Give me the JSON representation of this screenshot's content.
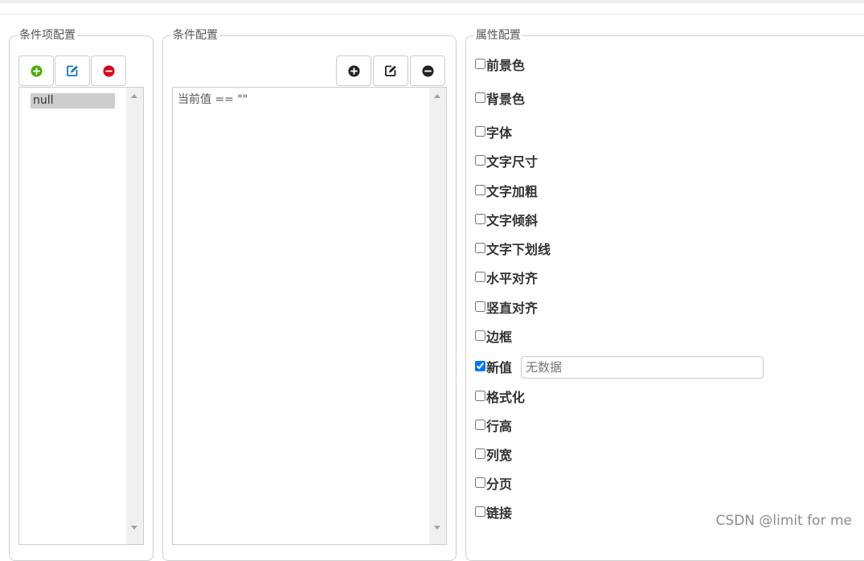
{
  "panels": {
    "condition_items": {
      "legend": "条件项配置",
      "items": [
        "null"
      ]
    },
    "condition_config": {
      "legend": "条件配置",
      "expression": "当前值 == \"\""
    },
    "property_config": {
      "legend": "属性配置",
      "properties": [
        {
          "label": "前景色",
          "checked": false
        },
        {
          "label": "背景色",
          "checked": false
        },
        {
          "label": "字体",
          "checked": false
        },
        {
          "label": "文字尺寸",
          "checked": false
        },
        {
          "label": "文字加粗",
          "checked": false
        },
        {
          "label": "文字倾斜",
          "checked": false
        },
        {
          "label": "文字下划线",
          "checked": false
        },
        {
          "label": "水平对齐",
          "checked": false
        },
        {
          "label": "竖直对齐",
          "checked": false
        },
        {
          "label": "边框",
          "checked": false
        },
        {
          "label": "新值",
          "checked": true
        },
        {
          "label": "格式化",
          "checked": false
        },
        {
          "label": "行高",
          "checked": false
        },
        {
          "label": "列宽",
          "checked": false
        },
        {
          "label": "分页",
          "checked": false
        },
        {
          "label": "链接",
          "checked": false
        }
      ],
      "new_value_input": {
        "value": "",
        "placeholder": "无数据"
      }
    }
  },
  "colors": {
    "add_green": "#4cae00",
    "edit_blue": "#1a73c8",
    "remove_red": "#d9001b",
    "dark_icon": "#222222"
  },
  "icons": {
    "left_toolbar": [
      "plus-circle-icon",
      "edit-icon",
      "minus-circle-icon"
    ],
    "middle_toolbar": [
      "plus-circle-icon",
      "edit-icon",
      "minus-circle-icon"
    ]
  },
  "watermark": "CSDN @limit for me"
}
